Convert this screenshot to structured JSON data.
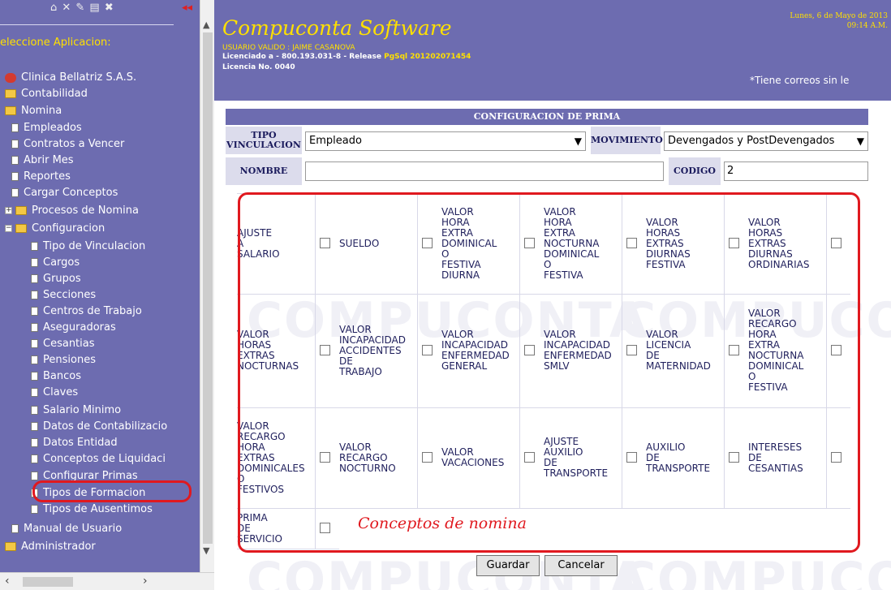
{
  "sidebar": {
    "toolbar_icons": "⌂ ✕ ✎ ▤ ✖",
    "red_mark": "◂◂",
    "select_label": "eleccione Aplicacion:",
    "items": [
      {
        "label": "Clinica Bellatriz S.A.S.",
        "icon": "bomb-icon",
        "level": 0
      },
      {
        "label": "Contabilidad",
        "icon": "folder-icon",
        "level": 0
      },
      {
        "label": "Nomina",
        "icon": "folder-open-icon",
        "level": 0
      },
      {
        "label": "Empleados",
        "icon": "page-icon",
        "level": 1
      },
      {
        "label": "Contratos a Vencer",
        "icon": "page-icon",
        "level": 1
      },
      {
        "label": "Abrir Mes",
        "icon": "page-icon",
        "level": 1
      },
      {
        "label": "Reportes",
        "icon": "page-icon",
        "level": 1
      },
      {
        "label": "Cargar Conceptos",
        "icon": "page-icon",
        "level": 1
      },
      {
        "label": "Procesos de Nomina",
        "icon": "folder-icon",
        "level": 1,
        "expander": "+"
      },
      {
        "label": "Configuracion",
        "icon": "folder-open-icon",
        "level": 1,
        "expander": "−"
      },
      {
        "label": "Tipo de Vinculacion",
        "icon": "page-icon",
        "level": 2
      },
      {
        "label": "Cargos",
        "icon": "page-icon",
        "level": 2
      },
      {
        "label": "Grupos",
        "icon": "page-icon",
        "level": 2
      },
      {
        "label": "Secciones",
        "icon": "page-icon",
        "level": 2
      },
      {
        "label": "Centros de Trabajo",
        "icon": "page-icon",
        "level": 2
      },
      {
        "label": "Aseguradoras",
        "icon": "page-icon",
        "level": 2
      },
      {
        "label": "Cesantias",
        "icon": "page-icon",
        "level": 2
      },
      {
        "label": "Pensiones",
        "icon": "page-icon",
        "level": 2
      },
      {
        "label": "Bancos",
        "icon": "page-icon",
        "level": 2
      },
      {
        "label": "Claves",
        "icon": "page-icon",
        "level": 2
      },
      {
        "label": "Salario Minimo",
        "icon": "page-icon",
        "level": 2
      },
      {
        "label": "Datos de Contabilizacio",
        "icon": "page-icon",
        "level": 2
      },
      {
        "label": "Datos Entidad",
        "icon": "page-icon",
        "level": 2
      },
      {
        "label": "Conceptos de Liquidaci",
        "icon": "page-icon",
        "level": 2
      },
      {
        "label": "Configurar Primas",
        "icon": "page-icon",
        "level": 2
      },
      {
        "label": "Tipos de Formacion",
        "icon": "page-icon",
        "level": 2
      },
      {
        "label": "Tipos de Ausentimos",
        "icon": "page-icon",
        "level": 2
      },
      {
        "label": "Manual de Usuario",
        "icon": "page-icon",
        "level": 1
      },
      {
        "label": "Administrador",
        "icon": "folder-icon",
        "level": 0
      }
    ]
  },
  "header": {
    "company": "Compuconta Software",
    "user": "USUARIO VALIDO : JAIME CASANOVA",
    "license_prefix": "Licenciado a  - 800.193.031-8 - Release ",
    "release": "PgSql 201202071454",
    "license_no": "Licencia No. 0040",
    "date": "Lunes, 6 de Mayo de 2013",
    "time": "09:14 A.M.",
    "mail_notice": "*Tiene correos sin le"
  },
  "form": {
    "title": "CONFIGURACION DE PRIMA",
    "tipo_label": "TIPO VINCULACION",
    "tipo_value": "Empleado",
    "movimiento_label": "MOVIMIENTO",
    "movimiento_value": "Devengados y PostDevengados",
    "nombre_label": "NOMBRE",
    "nombre_value": "",
    "codigo_label": "CODIGO",
    "codigo_value": "2"
  },
  "concepts": [
    "AJUSTE A SALARIO",
    "SUELDO",
    "VALOR HORA EXTRA DOMINICAL O FESTIVA DIURNA",
    "VALOR HORA EXTRA NOCTURNA DOMINICAL O FESTIVA",
    "VALOR HORAS EXTRAS DIURNAS FESTIVA",
    "VALOR HORAS EXTRAS DIURNAS ORDINARIAS",
    "VALOR HORAS EXTRAS NOCTURNAS",
    "VALOR INCAPACIDAD ACCIDENTES DE TRABAJO",
    "VALOR INCAPACIDAD ENFERMEDAD GENERAL",
    "VALOR INCAPACIDAD ENFERMEDAD SMLV",
    "VALOR LICENCIA DE MATERNIDAD",
    "VALOR RECARGO HORA EXTRA NOCTURNA DOMINICAL O FESTIVA",
    "VALOR RECARGO HORA EXTRAS DOMINICALES O FESTIVOS",
    "VALOR RECARGO NOCTURNO",
    "VALOR VACACIONES",
    "AJUSTE AUXILIO DE TRANSPORTE",
    "AUXILIO DE TRANSPORTE",
    "INTERESES DE CESANTIAS",
    "PRIMA DE SERVICIO"
  ],
  "annotation": "Conceptos de nomina",
  "buttons": {
    "save": "Guardar",
    "cancel": "Cancelar"
  },
  "watermark": "COMPUCONTA",
  "colors": {
    "header_bg": "#6d6cb0",
    "accent_yellow": "#ffe000",
    "highlight_red": "#e0191f"
  }
}
